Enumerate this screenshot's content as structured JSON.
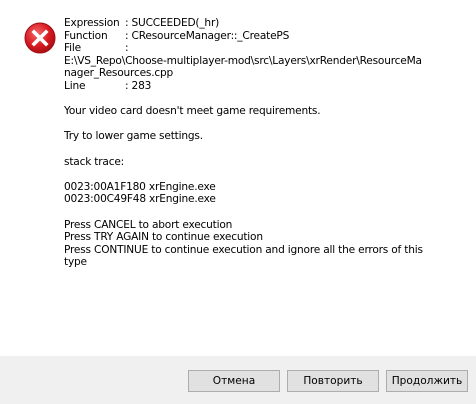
{
  "dialog": {
    "icon": "error-icon",
    "icon_color": "#e81123",
    "fields": [
      {
        "name": "Expression",
        "value": ": SUCCEEDED(_hr)"
      },
      {
        "name": "Function",
        "value": ": CResourceManager::_CreatePS"
      },
      {
        "name": "File",
        "value": ":"
      }
    ],
    "file_path_lines": [
      "E:\\VS_Repo\\Choose-multiplayer-mod\\src\\Layers\\xrRender\\ResourceMa",
      "nager_Resources.cpp"
    ],
    "line_field": {
      "name": "Line",
      "value": ": 283"
    },
    "message": "Your video card doesn't meet game requirements.",
    "hint": "Try to lower game settings.",
    "stack_label": "stack trace:",
    "stack": [
      "0023:00A1F180 xrEngine.exe",
      "0023:00C49F48 xrEngine.exe"
    ],
    "instructions": [
      "Press CANCEL to abort execution",
      "Press TRY AGAIN to continue execution",
      "Press CONTINUE to continue execution and ignore all the errors of this",
      "type"
    ]
  },
  "buttons": {
    "cancel": "Отмена",
    "retry": "Повторить",
    "continue": "Продолжить"
  }
}
